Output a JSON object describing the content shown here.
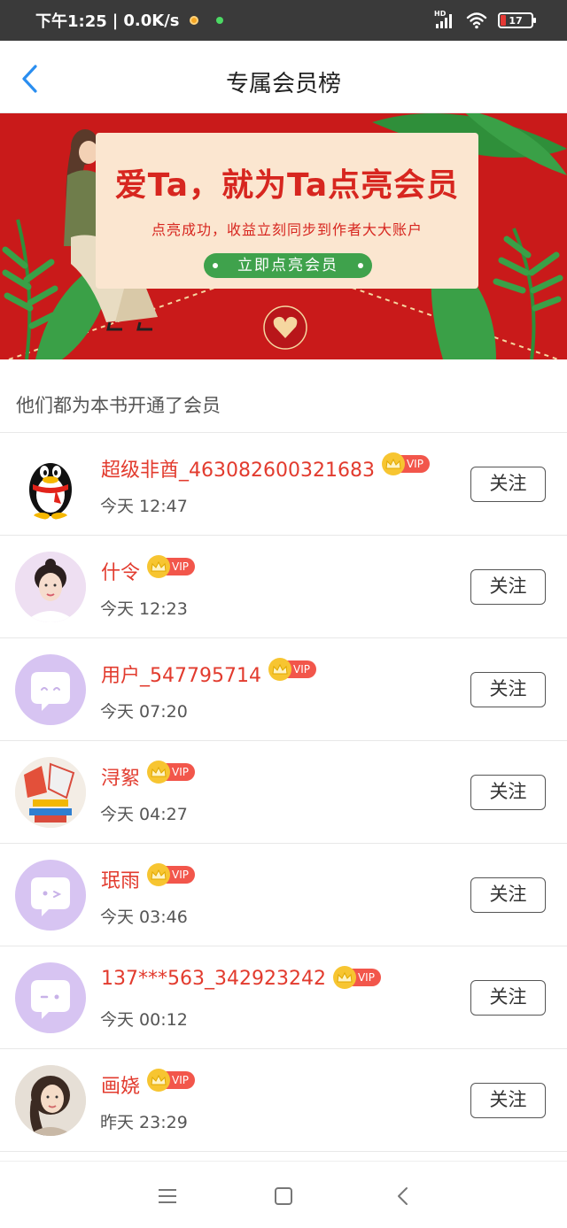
{
  "status_bar": {
    "time": "下午1:25",
    "separator": "|",
    "net_speed": "0.0K/s",
    "signal_label": "HD",
    "battery_level": "17",
    "colors": {
      "background": "#3a3a3a",
      "battery_low": "#e53935"
    },
    "icons": [
      "notification-dot-icon",
      "online-dot-icon",
      "signal-icon",
      "wifi-icon",
      "battery-icon"
    ]
  },
  "header": {
    "title": "专属会员榜",
    "back_icon": "chevron-left-icon",
    "accent_color": "#2a8ef0"
  },
  "banner": {
    "title": "爱Ta，就为Ta点亮会员",
    "subtitle": "点亮成功，收益立刻同步到作者大大账户",
    "cta_label": "立即点亮会员",
    "colors": {
      "background": "#c91a1a",
      "card": "#fbe6d0",
      "text": "#d7261f",
      "cta": "#3fa24c"
    }
  },
  "section": {
    "title": "他们都为本书开通了会员"
  },
  "members": [
    {
      "name": "超级非酋_463082600321683",
      "badge": "VIP",
      "time": "今天 12:47",
      "follow_label": "关注",
      "avatar_icon": "penguin-avatar"
    },
    {
      "name": "什令",
      "badge": "VIP",
      "time": "今天 12:23",
      "follow_label": "关注",
      "avatar_icon": "photo-avatar"
    },
    {
      "name": "用户_547795714",
      "badge": "VIP",
      "time": "今天 07:20",
      "follow_label": "关注",
      "avatar_icon": "default-avatar"
    },
    {
      "name": "浔絮",
      "badge": "VIP",
      "time": "今天 04:27",
      "follow_label": "关注",
      "avatar_icon": "photo-avatar"
    },
    {
      "name": "珉雨",
      "badge": "VIP",
      "time": "今天 03:46",
      "follow_label": "关注",
      "avatar_icon": "default-avatar"
    },
    {
      "name": "137***563_342923242",
      "badge": "VIP",
      "time": "今天 00:12",
      "follow_label": "关注",
      "avatar_icon": "default-avatar"
    },
    {
      "name": "画娆",
      "badge": "VIP",
      "time": "昨天 23:29",
      "follow_label": "关注",
      "avatar_icon": "photo-avatar"
    }
  ],
  "colors": {
    "name": "#e23b2e",
    "vip_badge": "#f2564b",
    "crown": "#f7c531",
    "default_avatar": "#d7c4f2"
  },
  "bottom_nav": {
    "icons": [
      "menu-icon",
      "home-square-icon",
      "back-triangle-icon"
    ]
  }
}
